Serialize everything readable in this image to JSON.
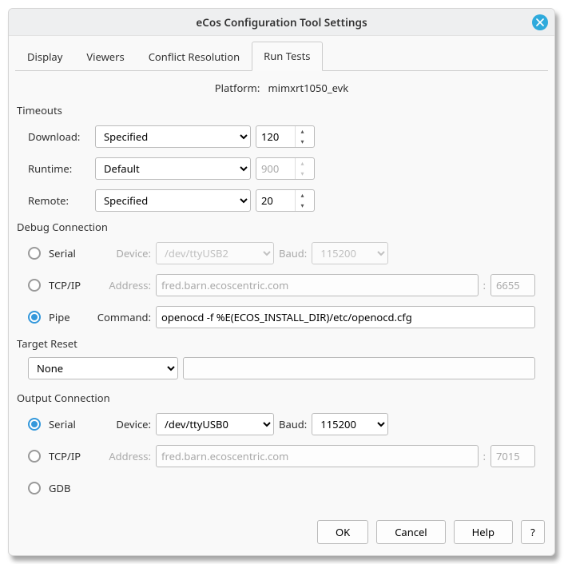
{
  "title": "eCos Configuration Tool Settings",
  "tabs": [
    "Display",
    "Viewers",
    "Conflict Resolution",
    "Run Tests"
  ],
  "active_tab": "Run Tests",
  "platform_label": "Platform:",
  "platform_value": "mimxrt1050_evk",
  "timeouts": {
    "heading": "Timeouts",
    "download_label": "Download:",
    "download_mode": "Specified",
    "download_value": "120",
    "runtime_label": "Runtime:",
    "runtime_mode": "Default",
    "runtime_value": "900",
    "remote_label": "Remote:",
    "remote_mode": "Specified",
    "remote_value": "20"
  },
  "debug": {
    "heading": "Debug Connection",
    "serial_label": "Serial",
    "serial_device_label": "Device:",
    "serial_device_value": "/dev/ttyUSB2",
    "serial_baud_label": "Baud:",
    "serial_baud_value": "115200",
    "tcp_label": "TCP/IP",
    "tcp_address_label": "Address:",
    "tcp_address_value": "fred.barn.ecoscentric.com",
    "tcp_port": "6655",
    "pipe_label": "Pipe",
    "pipe_command_label": "Command:",
    "pipe_command_value": "openocd -f %E(ECOS_INSTALL_DIR)/etc/openocd.cfg",
    "selected": "pipe"
  },
  "target_reset": {
    "heading": "Target Reset",
    "value": "None",
    "extra": ""
  },
  "output": {
    "heading": "Output Connection",
    "serial_label": "Serial",
    "serial_device_label": "Device:",
    "serial_device_value": "/dev/ttyUSB0",
    "serial_baud_label": "Baud:",
    "serial_baud_value": "115200",
    "tcp_label": "TCP/IP",
    "tcp_address_label": "Address:",
    "tcp_address_value": "fred.barn.ecoscentric.com",
    "tcp_port": "7015",
    "gdb_label": "GDB",
    "selected": "serial"
  },
  "buttons": {
    "ok": "OK",
    "cancel": "Cancel",
    "help": "Help",
    "q": "?"
  }
}
